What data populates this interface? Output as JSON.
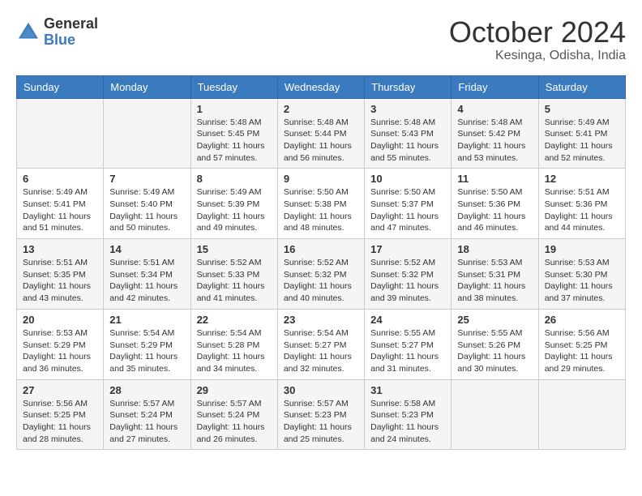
{
  "header": {
    "logo_line1": "General",
    "logo_line2": "Blue",
    "month": "October 2024",
    "location": "Kesinga, Odisha, India"
  },
  "weekdays": [
    "Sunday",
    "Monday",
    "Tuesday",
    "Wednesday",
    "Thursday",
    "Friday",
    "Saturday"
  ],
  "weeks": [
    [
      {
        "day": "",
        "sunrise": "",
        "sunset": "",
        "daylight": ""
      },
      {
        "day": "",
        "sunrise": "",
        "sunset": "",
        "daylight": ""
      },
      {
        "day": "1",
        "sunrise": "Sunrise: 5:48 AM",
        "sunset": "Sunset: 5:45 PM",
        "daylight": "Daylight: 11 hours and 57 minutes."
      },
      {
        "day": "2",
        "sunrise": "Sunrise: 5:48 AM",
        "sunset": "Sunset: 5:44 PM",
        "daylight": "Daylight: 11 hours and 56 minutes."
      },
      {
        "day": "3",
        "sunrise": "Sunrise: 5:48 AM",
        "sunset": "Sunset: 5:43 PM",
        "daylight": "Daylight: 11 hours and 55 minutes."
      },
      {
        "day": "4",
        "sunrise": "Sunrise: 5:48 AM",
        "sunset": "Sunset: 5:42 PM",
        "daylight": "Daylight: 11 hours and 53 minutes."
      },
      {
        "day": "5",
        "sunrise": "Sunrise: 5:49 AM",
        "sunset": "Sunset: 5:41 PM",
        "daylight": "Daylight: 11 hours and 52 minutes."
      }
    ],
    [
      {
        "day": "6",
        "sunrise": "Sunrise: 5:49 AM",
        "sunset": "Sunset: 5:41 PM",
        "daylight": "Daylight: 11 hours and 51 minutes."
      },
      {
        "day": "7",
        "sunrise": "Sunrise: 5:49 AM",
        "sunset": "Sunset: 5:40 PM",
        "daylight": "Daylight: 11 hours and 50 minutes."
      },
      {
        "day": "8",
        "sunrise": "Sunrise: 5:49 AM",
        "sunset": "Sunset: 5:39 PM",
        "daylight": "Daylight: 11 hours and 49 minutes."
      },
      {
        "day": "9",
        "sunrise": "Sunrise: 5:50 AM",
        "sunset": "Sunset: 5:38 PM",
        "daylight": "Daylight: 11 hours and 48 minutes."
      },
      {
        "day": "10",
        "sunrise": "Sunrise: 5:50 AM",
        "sunset": "Sunset: 5:37 PM",
        "daylight": "Daylight: 11 hours and 47 minutes."
      },
      {
        "day": "11",
        "sunrise": "Sunrise: 5:50 AM",
        "sunset": "Sunset: 5:36 PM",
        "daylight": "Daylight: 11 hours and 46 minutes."
      },
      {
        "day": "12",
        "sunrise": "Sunrise: 5:51 AM",
        "sunset": "Sunset: 5:36 PM",
        "daylight": "Daylight: 11 hours and 44 minutes."
      }
    ],
    [
      {
        "day": "13",
        "sunrise": "Sunrise: 5:51 AM",
        "sunset": "Sunset: 5:35 PM",
        "daylight": "Daylight: 11 hours and 43 minutes."
      },
      {
        "day": "14",
        "sunrise": "Sunrise: 5:51 AM",
        "sunset": "Sunset: 5:34 PM",
        "daylight": "Daylight: 11 hours and 42 minutes."
      },
      {
        "day": "15",
        "sunrise": "Sunrise: 5:52 AM",
        "sunset": "Sunset: 5:33 PM",
        "daylight": "Daylight: 11 hours and 41 minutes."
      },
      {
        "day": "16",
        "sunrise": "Sunrise: 5:52 AM",
        "sunset": "Sunset: 5:32 PM",
        "daylight": "Daylight: 11 hours and 40 minutes."
      },
      {
        "day": "17",
        "sunrise": "Sunrise: 5:52 AM",
        "sunset": "Sunset: 5:32 PM",
        "daylight": "Daylight: 11 hours and 39 minutes."
      },
      {
        "day": "18",
        "sunrise": "Sunrise: 5:53 AM",
        "sunset": "Sunset: 5:31 PM",
        "daylight": "Daylight: 11 hours and 38 minutes."
      },
      {
        "day": "19",
        "sunrise": "Sunrise: 5:53 AM",
        "sunset": "Sunset: 5:30 PM",
        "daylight": "Daylight: 11 hours and 37 minutes."
      }
    ],
    [
      {
        "day": "20",
        "sunrise": "Sunrise: 5:53 AM",
        "sunset": "Sunset: 5:29 PM",
        "daylight": "Daylight: 11 hours and 36 minutes."
      },
      {
        "day": "21",
        "sunrise": "Sunrise: 5:54 AM",
        "sunset": "Sunset: 5:29 PM",
        "daylight": "Daylight: 11 hours and 35 minutes."
      },
      {
        "day": "22",
        "sunrise": "Sunrise: 5:54 AM",
        "sunset": "Sunset: 5:28 PM",
        "daylight": "Daylight: 11 hours and 34 minutes."
      },
      {
        "day": "23",
        "sunrise": "Sunrise: 5:54 AM",
        "sunset": "Sunset: 5:27 PM",
        "daylight": "Daylight: 11 hours and 32 minutes."
      },
      {
        "day": "24",
        "sunrise": "Sunrise: 5:55 AM",
        "sunset": "Sunset: 5:27 PM",
        "daylight": "Daylight: 11 hours and 31 minutes."
      },
      {
        "day": "25",
        "sunrise": "Sunrise: 5:55 AM",
        "sunset": "Sunset: 5:26 PM",
        "daylight": "Daylight: 11 hours and 30 minutes."
      },
      {
        "day": "26",
        "sunrise": "Sunrise: 5:56 AM",
        "sunset": "Sunset: 5:25 PM",
        "daylight": "Daylight: 11 hours and 29 minutes."
      }
    ],
    [
      {
        "day": "27",
        "sunrise": "Sunrise: 5:56 AM",
        "sunset": "Sunset: 5:25 PM",
        "daylight": "Daylight: 11 hours and 28 minutes."
      },
      {
        "day": "28",
        "sunrise": "Sunrise: 5:57 AM",
        "sunset": "Sunset: 5:24 PM",
        "daylight": "Daylight: 11 hours and 27 minutes."
      },
      {
        "day": "29",
        "sunrise": "Sunrise: 5:57 AM",
        "sunset": "Sunset: 5:24 PM",
        "daylight": "Daylight: 11 hours and 26 minutes."
      },
      {
        "day": "30",
        "sunrise": "Sunrise: 5:57 AM",
        "sunset": "Sunset: 5:23 PM",
        "daylight": "Daylight: 11 hours and 25 minutes."
      },
      {
        "day": "31",
        "sunrise": "Sunrise: 5:58 AM",
        "sunset": "Sunset: 5:23 PM",
        "daylight": "Daylight: 11 hours and 24 minutes."
      },
      {
        "day": "",
        "sunrise": "",
        "sunset": "",
        "daylight": ""
      },
      {
        "day": "",
        "sunrise": "",
        "sunset": "",
        "daylight": ""
      }
    ]
  ]
}
